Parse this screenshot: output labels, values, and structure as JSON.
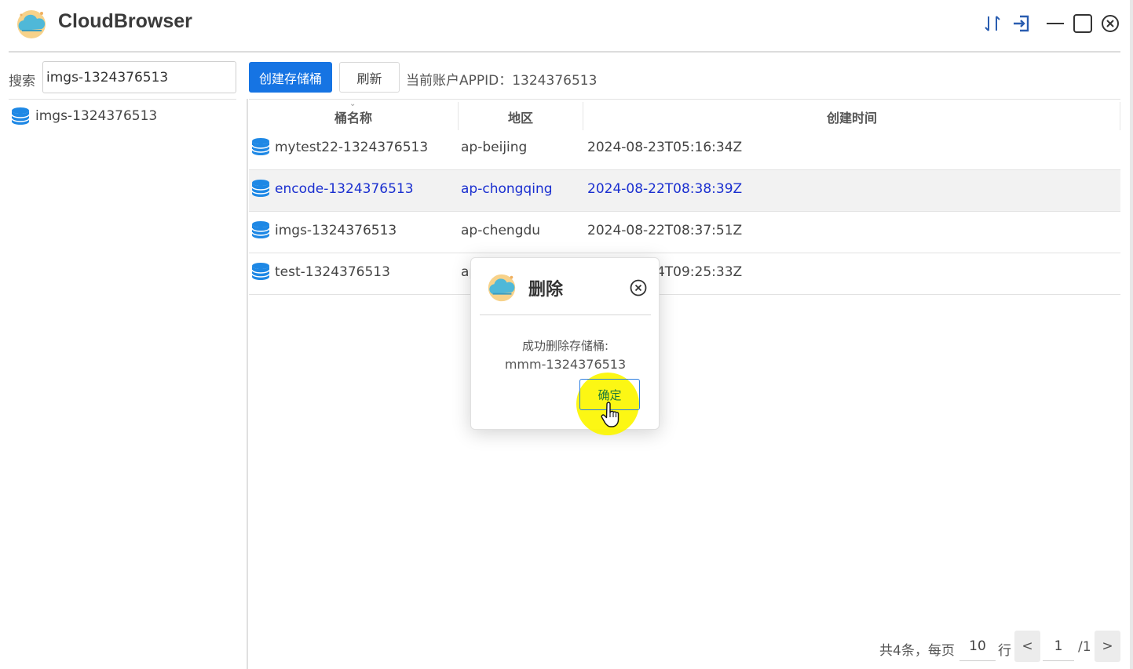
{
  "app": {
    "title": "CloudBrowser",
    "logo_icon": "cloud-logo-icon"
  },
  "window_controls": {
    "sort_icon": "sort-arrows-icon",
    "logout_icon": "sign-out-icon",
    "minimize_icon": "minimize-icon",
    "maximize_icon": "maximize-icon",
    "close_icon": "close-circle-icon"
  },
  "sidebar": {
    "search_label": "搜索",
    "search_value": "imgs-1324376513",
    "items": [
      {
        "label": "imgs-1324376513",
        "icon": "bucket-icon"
      }
    ]
  },
  "toolbar": {
    "create_label": "创建存储桶",
    "refresh_label": "刷新",
    "appid_text": "当前账户APPID：1324376513"
  },
  "table": {
    "headers": [
      "桶名称",
      "地区",
      "创建时间"
    ],
    "rows": [
      {
        "name": "mytest22-1324376513",
        "region": "ap-beijing",
        "created": "2024-08-23T05:16:34Z"
      },
      {
        "name": "encode-1324376513",
        "region": "ap-chongqing",
        "created": "2024-08-22T08:38:39Z",
        "selected": true
      },
      {
        "name": "imgs-1324376513",
        "region": "ap-chengdu",
        "created": "2024-08-22T08:37:51Z"
      },
      {
        "name": "test-1324376513",
        "region": "ap-",
        "created": "2024-08-14T09:25:33Z"
      }
    ]
  },
  "pagination": {
    "summary": "共4条，每页",
    "page_size": "10",
    "rows_suffix": "行",
    "prev_label": "<",
    "current_page": "1",
    "total_pages": "/1",
    "next_label": ">"
  },
  "dialog": {
    "title": "删除",
    "message_line1": "成功删除存储桶:",
    "message_line2": "mmm-1324376513",
    "ok_label": "确定"
  },
  "colors": {
    "primary": "#1674e3",
    "selected_text": "#1a2fd0",
    "bucket_icon": "#1e88e5",
    "cursor_highlight": "#fcf600"
  }
}
